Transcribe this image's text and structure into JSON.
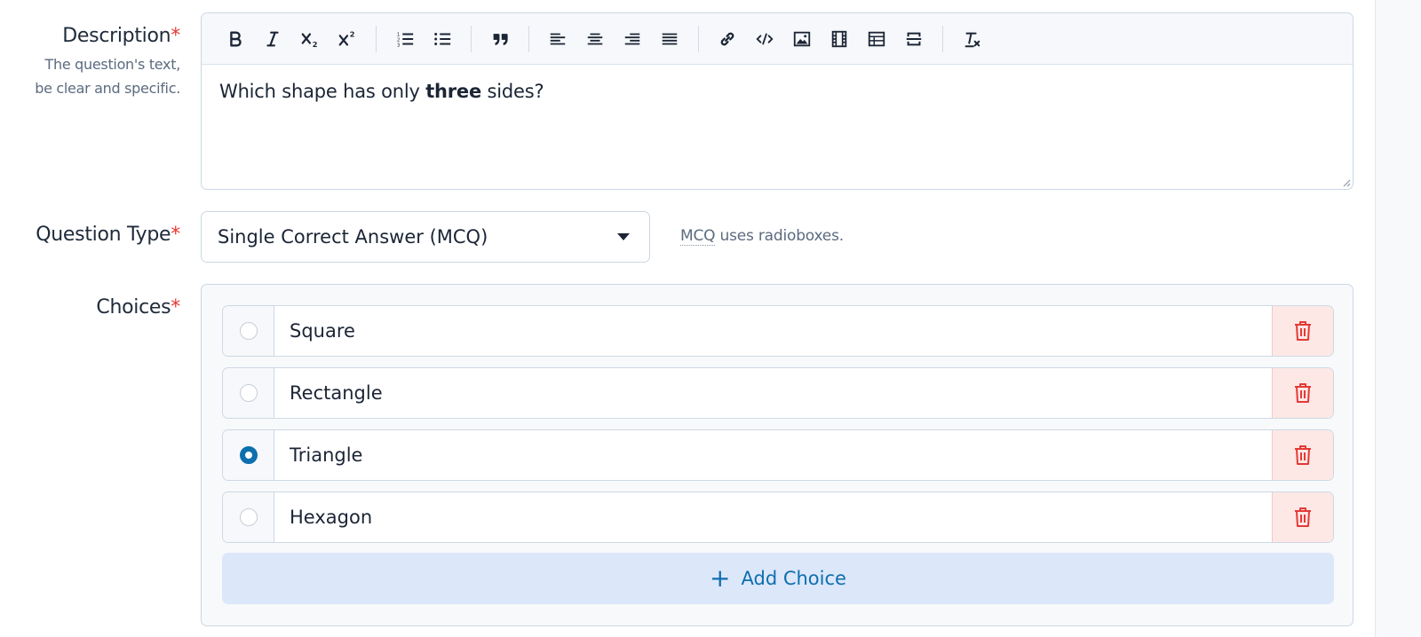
{
  "description": {
    "label": "Description",
    "required_mark": "*",
    "help_line1": "The question's text,",
    "help_line2": "be clear and specific.",
    "content_before": "Which shape has only ",
    "content_bold": "three",
    "content_after": " sides?",
    "toolbar": [
      "bold-icon",
      "italic-icon",
      "subscript-icon",
      "superscript-icon",
      "ordered-list-icon",
      "bullet-list-icon",
      "blockquote-icon",
      "align-left-icon",
      "align-center-icon",
      "align-right-icon",
      "justify-icon",
      "link-icon",
      "code-icon",
      "image-icon",
      "video-icon",
      "table-icon",
      "page-break-icon",
      "clear-format-icon"
    ]
  },
  "question_type": {
    "label": "Question Type",
    "required_mark": "*",
    "selected": "Single Correct Answer (MCQ)",
    "help_abbr": "MCQ",
    "help_rest": " uses radioboxes."
  },
  "choices": {
    "label": "Choices",
    "required_mark": "*",
    "items": [
      {
        "text": "Square",
        "selected": false
      },
      {
        "text": "Rectangle",
        "selected": false
      },
      {
        "text": "Triangle",
        "selected": true
      },
      {
        "text": "Hexagon",
        "selected": false
      }
    ],
    "add_label": "Add Choice"
  },
  "colors": {
    "accent": "#0d6fae",
    "danger": "#e53935",
    "danger_bg": "#fde8e6",
    "add_bg": "#dde7fa"
  }
}
